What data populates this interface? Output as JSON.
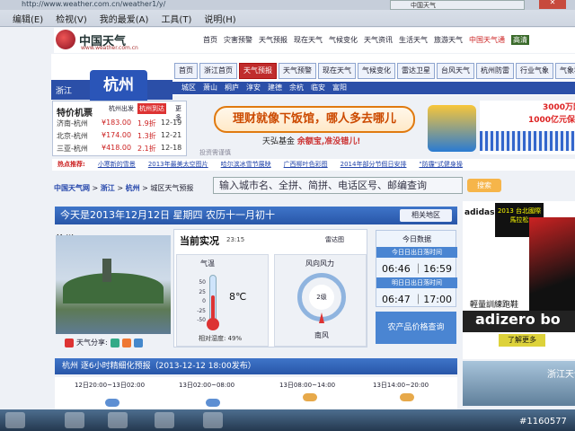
{
  "browser": {
    "url": "http://www.weather.com.cn/weather1/y/",
    "tab_title": "中国天气",
    "menus": [
      "编辑(E)",
      "检视(V)",
      "我的最爱(A)",
      "工具(T)",
      "说明(H)"
    ]
  },
  "site": {
    "logo_text": "中国天气",
    "logo_sub": "www.weather.com.cn",
    "top_nav": [
      "首页",
      "灾害预警",
      "天气预报",
      "现在天气",
      "气候变化",
      "天气资讯",
      "生活天气",
      "旅游天气",
      "中国天气通",
      "高清"
    ],
    "province": "浙江",
    "city": "杭州",
    "tabs": [
      "首页",
      "浙江首页",
      "天气预报",
      "天气预警",
      "现在天气",
      "气候变化",
      "雷达卫星",
      "台风天气",
      "杭州防雷",
      "行业气象",
      "气象科普"
    ],
    "active_tab": "天气预报",
    "districts": [
      "城区",
      "萧山",
      "桐庐",
      "淳安",
      "建德",
      "余杭",
      "临安",
      "富阳"
    ]
  },
  "ticket": {
    "title": "特价机票",
    "departure": "杭州出发",
    "hot": "杭州到达",
    "more": "更多",
    "rows": [
      {
        "route": "济南-杭州",
        "price": "¥183.00",
        "discount": "1.9折",
        "date": "12-19"
      },
      {
        "route": "北京-杭州",
        "price": "¥174.00",
        "discount": "1.3折",
        "date": "12-21"
      },
      {
        "route": "三亚-杭州",
        "price": "¥418.00",
        "discount": "2.1折",
        "date": "12-18"
      }
    ]
  },
  "ads": {
    "banner_main": "理财就像下饭馆，哪人多去哪儿",
    "banner_sub_a": "天弘基金",
    "banner_sub_b": "余额宝,准没错儿!",
    "banner_note": "投资需谨慎",
    "right_top_1": "3000万网店",
    "right_top_2": "1000亿元保障",
    "sport_brand": "adidas",
    "sport_tag": "2013 台北國際馬拉松",
    "sport_line1": "輕量訓練跑鞋",
    "sport_line2": "adizero bo",
    "sport_cta": "了解更多",
    "bottom_right": "浙江天气"
  },
  "hot_links": {
    "label": "热点推荐:",
    "items": [
      "小寒新的雪景",
      "2013年最美太空图片",
      "哈尔滨冰雪节展映",
      "广西柳叶色彩图",
      "2014年部分节假日安排",
      "\"防霾\"式健身操"
    ]
  },
  "breadcrumb": {
    "home": "中国天气网",
    "sep": ">",
    "province": "浙江",
    "city": "杭州",
    "page": "城区天气预报"
  },
  "search": {
    "placeholder": "输入城市名、全拼、简拼、电话区号、邮编查询",
    "button": "搜索"
  },
  "today": {
    "date_text": "今天是2013年12月12日 星期四 农历十一月初十",
    "related": "相关地区"
  },
  "city_card": {
    "title": "杭州(Hangzhou)",
    "share_label": "天气分享:"
  },
  "current": {
    "title": "当前实况",
    "time": "23:15",
    "radar": "雷达图",
    "temp_label": "气温",
    "temp_scale": [
      "50",
      "25",
      "0",
      "-25",
      "-50"
    ],
    "temp_value": "8℃",
    "humidity": "相对湿度: 49%",
    "wind_label": "风向风力",
    "wind_level": "2级",
    "wind_dir": "南风",
    "temp_c": 8,
    "temp_min": -50,
    "temp_max": 50
  },
  "sun": {
    "title": "今日数据",
    "today_label": "今日日出日落时间",
    "today_value": "06:46 ｜16:59",
    "tomorrow_label": "明日日出日落时间",
    "tomorrow_value": "06:47 ｜17:00"
  },
  "farm": "农产品价格查询",
  "forecast": {
    "title": "杭州 逐6小时精细化预报（2013-12-12  18:00发布）",
    "slots": [
      "12日20:00~13日02:00",
      "13日02:00~08:00",
      "13日08:00~14:00",
      "13日14:00~20:00"
    ]
  },
  "watermark": "#1160577"
}
